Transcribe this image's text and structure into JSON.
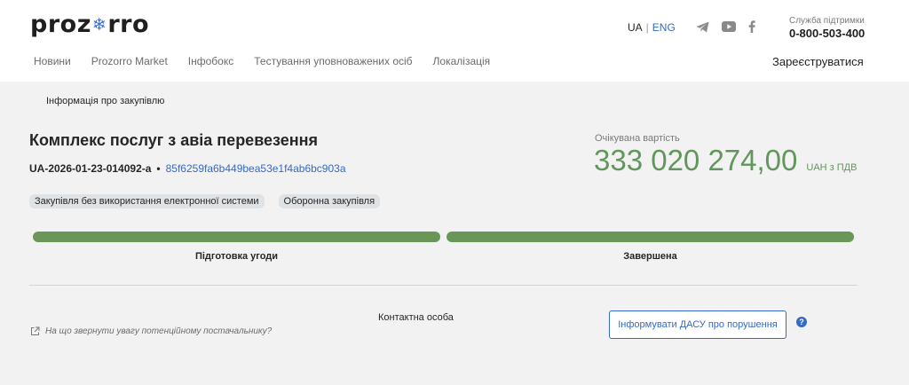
{
  "header": {
    "logo_left": "proz",
    "logo_right": "rro",
    "lang_ua": "UA",
    "lang_sep": "|",
    "lang_eng": "ENG",
    "support_label": "Служба підтримки",
    "support_phone": "0-800-503-400",
    "social_icons": [
      "telegram-icon",
      "youtube-icon",
      "facebook-icon"
    ]
  },
  "nav": {
    "items": [
      "Новини",
      "Prozorro Market",
      "Інфобокс",
      "Тестування уповноважених осіб",
      "Локалізація"
    ],
    "register": "Зареєструватися"
  },
  "breadcrumb": "Інформація про закупівлю",
  "tender": {
    "title": "Комплекс послуг з авіа перевезення",
    "id": "UA-2026-01-23-014092-a",
    "separator": "•",
    "hash": "85f6259fa6b449bea53e1f4ab6bc903a",
    "tags": [
      "Закупівля без використання електронної системи",
      "Оборонна закупівля"
    ],
    "cost_label": "Очікувана вартість",
    "cost_amount": "333 020 274,00",
    "cost_currency": "UAH з ПДВ"
  },
  "progress": {
    "stages": [
      {
        "label": "Підготовка угоди",
        "fill": 1.0
      },
      {
        "label": "Завершена",
        "fill": 1.0
      }
    ]
  },
  "bottom": {
    "hint": "На що звернути увагу потенційному постачальнику?",
    "contact": "Контактна особа",
    "dasu_button": "Інформувати ДАСУ про порушення",
    "help_glyph": "?"
  },
  "colors": {
    "accent_blue": "#3769c6",
    "success_green": "#62965d",
    "progress_green": "#6a9657"
  }
}
